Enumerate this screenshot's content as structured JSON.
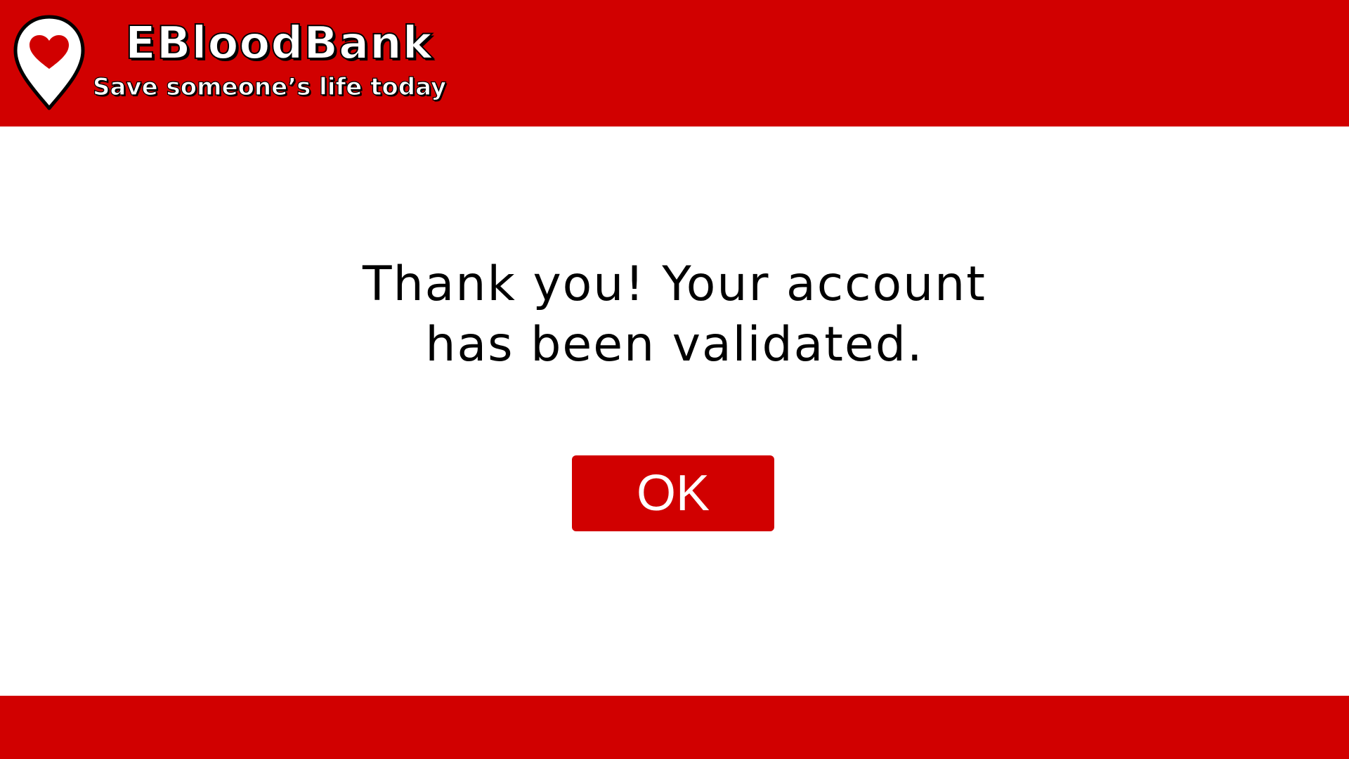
{
  "header": {
    "brand_name": "EBloodBank",
    "tagline": "Save someone’s life today",
    "logo_icon": "heart-location-pin-icon"
  },
  "main": {
    "message_line1": "Thank you! Your account",
    "message_line2": "has been validated.",
    "ok_label": "OK"
  },
  "colors": {
    "brand_red": "#d10000",
    "background": "#ffffff",
    "text": "#000000"
  }
}
